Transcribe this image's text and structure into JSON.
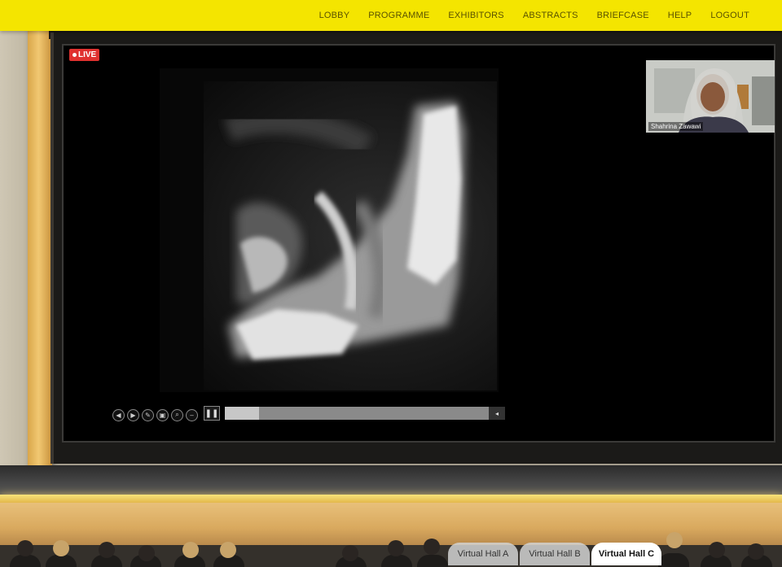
{
  "nav": {
    "items": [
      "LOBBY",
      "PROGRAMME",
      "EXHIBITORS",
      "ABSTRACTS",
      "BRIEFCASE",
      "HELP",
      "LOGOUT"
    ]
  },
  "stream": {
    "live_label": "LIVE",
    "progress": 0.13
  },
  "webcam": {
    "speaker_name": "Shahrina Zawawi"
  },
  "hall_tabs": {
    "items": [
      "Virtual Hall A",
      "Virtual Hall B",
      "Virtual Hall C"
    ],
    "active": "Virtual Hall C"
  },
  "colors": {
    "topbar": "#f4e500",
    "live": "#e0312f",
    "pillar_gold": "#f1c872"
  },
  "icons": {
    "controls": [
      "rewind-icon",
      "forward-icon",
      "pen-icon",
      "image-icon",
      "zoom-icon",
      "minus-icon"
    ],
    "pause": "pause-icon",
    "end": "chevron-left-icon"
  }
}
